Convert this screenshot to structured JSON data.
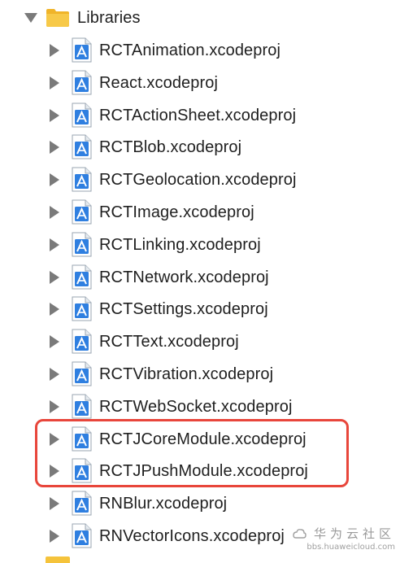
{
  "navigator": {
    "group": {
      "label": "Libraries",
      "icon": "folder-icon",
      "expanded": true
    },
    "items": [
      {
        "label": "RCTAnimation.xcodeproj",
        "icon": "xcodeproj-icon"
      },
      {
        "label": "React.xcodeproj",
        "icon": "xcodeproj-icon"
      },
      {
        "label": "RCTActionSheet.xcodeproj",
        "icon": "xcodeproj-icon"
      },
      {
        "label": "RCTBlob.xcodeproj",
        "icon": "xcodeproj-icon"
      },
      {
        "label": "RCTGeolocation.xcodeproj",
        "icon": "xcodeproj-icon"
      },
      {
        "label": "RCTImage.xcodeproj",
        "icon": "xcodeproj-icon"
      },
      {
        "label": "RCTLinking.xcodeproj",
        "icon": "xcodeproj-icon"
      },
      {
        "label": "RCTNetwork.xcodeproj",
        "icon": "xcodeproj-icon"
      },
      {
        "label": "RCTSettings.xcodeproj",
        "icon": "xcodeproj-icon"
      },
      {
        "label": "RCTText.xcodeproj",
        "icon": "xcodeproj-icon"
      },
      {
        "label": "RCTVibration.xcodeproj",
        "icon": "xcodeproj-icon"
      },
      {
        "label": "RCTWebSocket.xcodeproj",
        "icon": "xcodeproj-icon"
      },
      {
        "label": "RCTJCoreModule.xcodeproj",
        "icon": "xcodeproj-icon",
        "highlighted": true
      },
      {
        "label": "RCTJPushModule.xcodeproj",
        "icon": "xcodeproj-icon",
        "highlighted": true
      },
      {
        "label": "RNBlur.xcodeproj",
        "icon": "xcodeproj-icon"
      },
      {
        "label": "RNVectorIcons.xcodeproj",
        "icon": "xcodeproj-icon"
      }
    ]
  },
  "colors": {
    "highlight_border": "#e8463b",
    "folder": "#f5c33b",
    "project_icon": "#2f7fe0"
  },
  "watermark": {
    "title": "华为云社区",
    "url": "bbs.huaweicloud.com"
  }
}
